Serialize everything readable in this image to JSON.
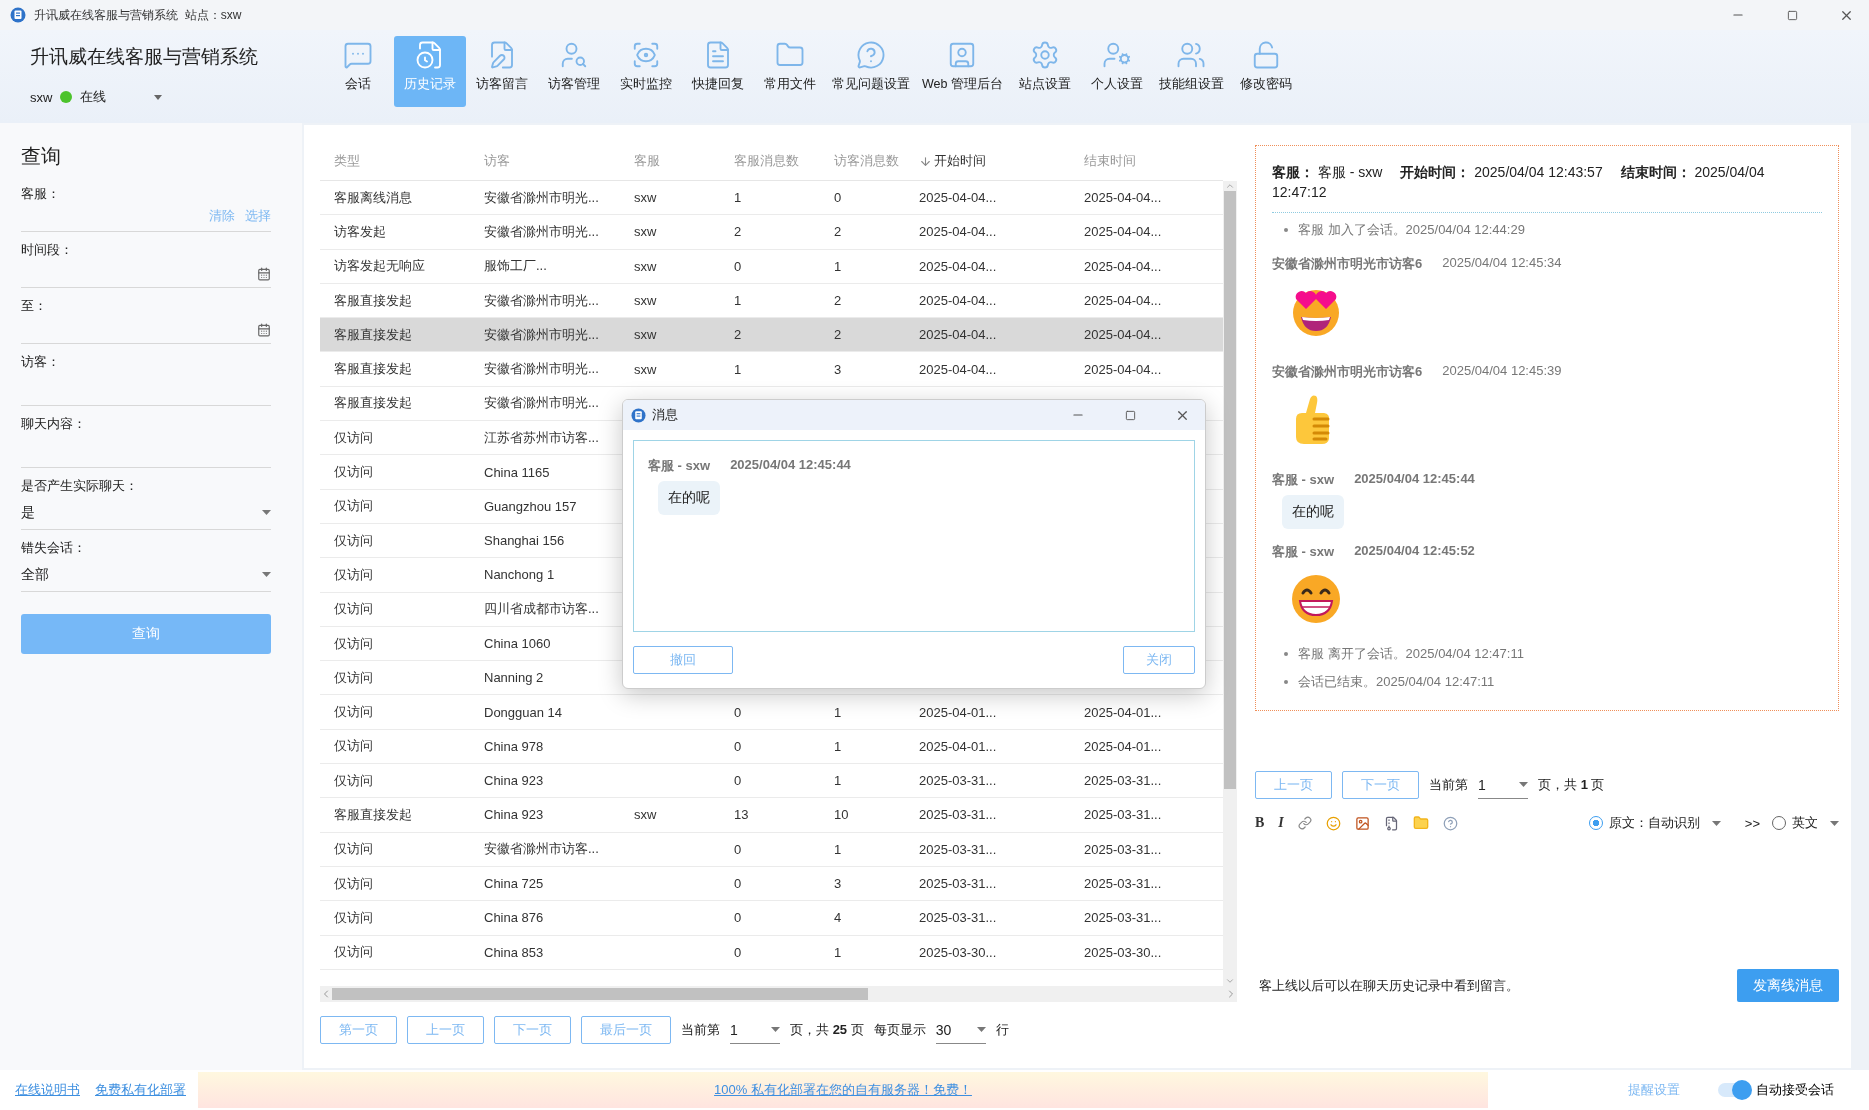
{
  "window": {
    "title": "升讯威在线客服与营销系统",
    "site": "站点：sxw"
  },
  "header": {
    "app_name": "升讯威在线客服与营销系统",
    "user": "sxw",
    "status": "在线",
    "online": true
  },
  "toolbar": [
    {
      "label": "会话",
      "selected": false
    },
    {
      "label": "历史记录",
      "selected": true
    },
    {
      "label": "访客留言",
      "selected": false
    },
    {
      "label": "访客管理",
      "selected": false
    },
    {
      "label": "实时监控",
      "selected": false
    },
    {
      "label": "快捷回复",
      "selected": false
    },
    {
      "label": "常用文件",
      "selected": false
    },
    {
      "label": "常见问题设置",
      "selected": false
    },
    {
      "label": "Web 管理后台",
      "selected": false
    },
    {
      "label": "站点设置",
      "selected": false
    },
    {
      "label": "个人设置",
      "selected": false
    },
    {
      "label": "技能组设置",
      "selected": false
    },
    {
      "label": "修改密码",
      "selected": false
    }
  ],
  "query": {
    "title": "查询",
    "fields": [
      {
        "kind": "picker",
        "label": "客服：",
        "actions": [
          "清除",
          "选择"
        ]
      },
      {
        "kind": "date",
        "label": "时间段："
      },
      {
        "kind": "date",
        "label": "至："
      },
      {
        "kind": "text",
        "label": "访客："
      },
      {
        "kind": "text",
        "label": "聊天内容："
      },
      {
        "kind": "select",
        "label": "是否产生实际聊天：",
        "value": "是"
      },
      {
        "kind": "select",
        "label": "错失会话：",
        "value": "全部"
      }
    ],
    "button": "查询"
  },
  "table": {
    "columns": [
      {
        "label": "类型",
        "sorted": false
      },
      {
        "label": "访客",
        "sorted": false
      },
      {
        "label": "客服",
        "sorted": false
      },
      {
        "label": "客服消息数",
        "sorted": false
      },
      {
        "label": "访客消息数",
        "sorted": false
      },
      {
        "label": "开始时间",
        "sorted": true
      },
      {
        "label": "结束时间",
        "sorted": false
      }
    ],
    "rows": [
      {
        "selected": false,
        "cells": [
          "客服离线消息",
          "安徽省滁州市明光...",
          "sxw",
          "1",
          "0",
          "2025-04-04...",
          "2025-04-04..."
        ]
      },
      {
        "selected": false,
        "cells": [
          "访客发起",
          "安徽省滁州市明光...",
          "sxw",
          "2",
          "2",
          "2025-04-04...",
          "2025-04-04..."
        ]
      },
      {
        "selected": false,
        "cells": [
          "访客发起无响应",
          "服饰工厂...",
          "sxw",
          "0",
          "1",
          "2025-04-04...",
          "2025-04-04..."
        ]
      },
      {
        "selected": false,
        "cells": [
          "客服直接发起",
          "安徽省滁州市明光...",
          "sxw",
          "1",
          "2",
          "2025-04-04...",
          "2025-04-04..."
        ]
      },
      {
        "selected": true,
        "cells": [
          "客服直接发起",
          "安徽省滁州市明光...",
          "sxw",
          "2",
          "2",
          "2025-04-04...",
          "2025-04-04..."
        ]
      },
      {
        "selected": false,
        "cells": [
          "客服直接发起",
          "安徽省滁州市明光...",
          "sxw",
          "1",
          "3",
          "2025-04-04...",
          "2025-04-04..."
        ]
      },
      {
        "selected": false,
        "cells": [
          "客服直接发起",
          "安徽省滁州市明光..."
        ]
      },
      {
        "selected": false,
        "cells": [
          "仅访问",
          "江苏省苏州市访客..."
        ]
      },
      {
        "selected": false,
        "cells": [
          "仅访问",
          "China 1165"
        ]
      },
      {
        "selected": false,
        "cells": [
          "仅访问",
          "Guangzhou 157"
        ]
      },
      {
        "selected": false,
        "cells": [
          "仅访问",
          "Shanghai 156"
        ]
      },
      {
        "selected": false,
        "cells": [
          "仅访问",
          "Nanchong 1"
        ]
      },
      {
        "selected": false,
        "cells": [
          "仅访问",
          "四川省成都市访客..."
        ]
      },
      {
        "selected": false,
        "cells": [
          "仅访问",
          "China 1060"
        ]
      },
      {
        "selected": false,
        "cells": [
          "仅访问",
          "Nanning 2"
        ]
      },
      {
        "selected": false,
        "cells": [
          "仅访问",
          "Dongguan 14",
          null,
          "0",
          "1",
          "2025-04-01...",
          "2025-04-01..."
        ]
      },
      {
        "selected": false,
        "cells": [
          "仅访问",
          "China 978",
          null,
          "0",
          "1",
          "2025-04-01...",
          "2025-04-01..."
        ]
      },
      {
        "selected": false,
        "cells": [
          "仅访问",
          "China 923",
          null,
          "0",
          "1",
          "2025-03-31...",
          "2025-03-31..."
        ]
      },
      {
        "selected": false,
        "cells": [
          "客服直接发起",
          "China 923",
          "sxw",
          "13",
          "10",
          "2025-03-31...",
          "2025-03-31..."
        ]
      },
      {
        "selected": false,
        "cells": [
          "仅访问",
          "安徽省滁州市访客...",
          null,
          "0",
          "1",
          "2025-03-31...",
          "2025-03-31..."
        ]
      },
      {
        "selected": false,
        "cells": [
          "仅访问",
          "China 725",
          null,
          "0",
          "3",
          "2025-03-31...",
          "2025-03-31..."
        ]
      },
      {
        "selected": false,
        "cells": [
          "仅访问",
          "China 876",
          null,
          "0",
          "4",
          "2025-03-31...",
          "2025-03-31..."
        ]
      },
      {
        "selected": false,
        "cells": [
          "仅访问",
          "China 853",
          null,
          "0",
          "1",
          "2025-03-30...",
          "2025-03-30..."
        ]
      }
    ]
  },
  "pagination": {
    "buttons": [
      "第一页",
      "上一页",
      "下一页",
      "最后一页"
    ],
    "current_label": "当前第",
    "page": "1",
    "total": "页，共 **25** 页",
    "per_page_label": "每页显示",
    "per_page": "30",
    "rows_label": "行"
  },
  "message_dialog": {
    "title": "消息",
    "sender": "客服 - sxw",
    "time": "2025/04/04 12:45:44",
    "text": "在的呢",
    "buttons": [
      "撤回",
      "关闭"
    ]
  },
  "transcript": {
    "summary": "**客服：** 客服 - sxw　 **开始时间：** 2025/04/04 12:43:57　 **结束时间：** 2025/04/04 12:47:12",
    "entries": [
      {
        "kind": "event",
        "text": "客服 加入了会话。2025/04/04 12:44:29"
      },
      {
        "kind": "hearteyes",
        "from_agent": false,
        "sender": "安徽省滁州市明光市访客6",
        "time": "2025/04/04 12:45:34"
      },
      {
        "kind": "thumbsup",
        "from_agent": false,
        "sender": "安徽省滁州市明光市访客6",
        "time": "2025/04/04 12:45:39"
      },
      {
        "kind": "text",
        "from_agent": true,
        "sender": "客服 - sxw",
        "time": "2025/04/04 12:45:44",
        "text": "在的呢"
      },
      {
        "kind": "grin",
        "from_agent": true,
        "sender": "客服 - sxw",
        "time": "2025/04/04 12:45:52"
      },
      {
        "kind": "event",
        "text": "客服 离开了会话。2025/04/04 12:47:11"
      },
      {
        "kind": "event",
        "text": "会话已结束。2025/04/04 12:47:11"
      }
    ],
    "pagination": {
      "buttons": [
        "上一页",
        "下一页"
      ],
      "current_label": "当前第",
      "page": "1",
      "total": "页，共 **1** 页"
    }
  },
  "editor": {
    "format_buttons": [
      "B",
      "I"
    ],
    "languages": [
      {
        "label": "原文：自动识别",
        "selected": true
      },
      {
        "label": "英文",
        "selected": false
      }
    ],
    "arrow": ">>",
    "note": "客上线以后可以在聊天历史记录中看到留言。",
    "send_button": "发离线消息"
  },
  "footer": {
    "links": [
      "在线说明书",
      "免费私有化部署"
    ],
    "banner": "100% 私有化部署在您的自有服务器！免费！",
    "reminder": "提醒设置",
    "auto_accept": {
      "label": "自动接受会话",
      "on": true
    }
  }
}
